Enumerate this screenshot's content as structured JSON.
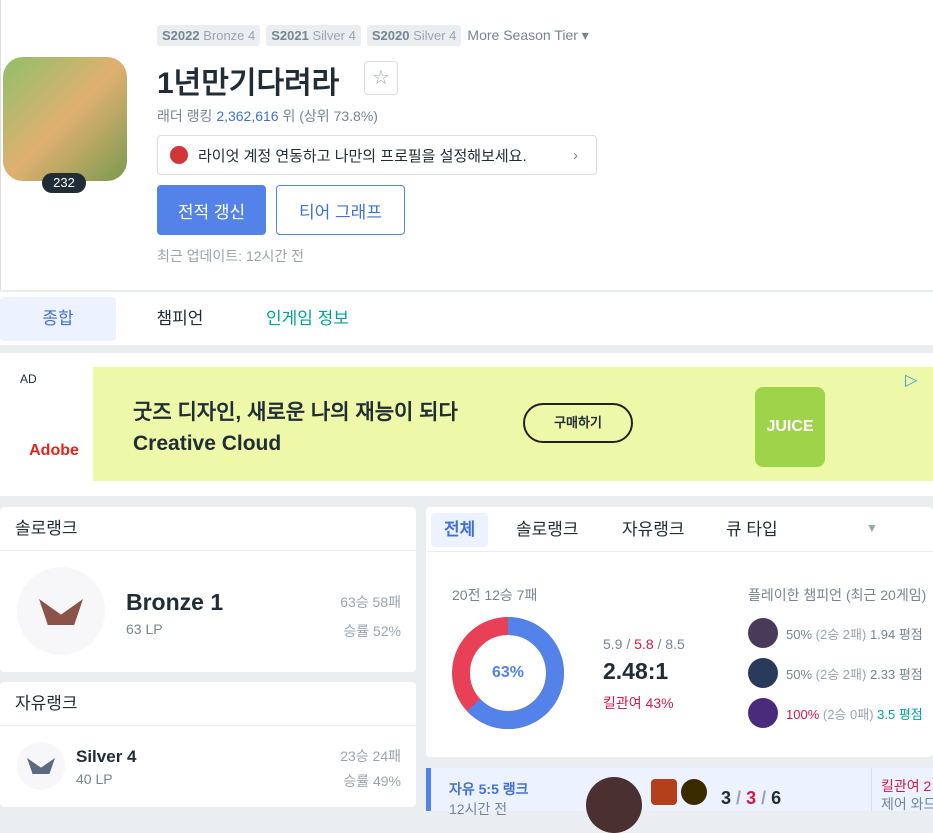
{
  "seasons": [
    {
      "s": "S2022",
      "t": "Bronze 4"
    },
    {
      "s": "S2021",
      "t": "Silver 4"
    },
    {
      "s": "S2020",
      "t": "Silver 4"
    }
  ],
  "more_season": "More Season Tier ▾",
  "profile": {
    "level": "232",
    "name": "1년만기다려라",
    "rank_label": "래더 랭킹",
    "rank_num": "2,362,616",
    "rank_suffix": "위 (상위 73.8%)",
    "riot_banner": "라이엇 계정 연동하고 나만의 프로필을 설정해보세요.",
    "refresh": "전적 갱신",
    "tier_graph": "티어 그래프",
    "updated": "최근 업데이트: 12시간 전"
  },
  "tabs": [
    "종합",
    "챔피언",
    "인게임 정보"
  ],
  "ad": {
    "label": "AD",
    "brand": "Adobe",
    "line1": "굿즈 디자인, 새로운 나의 재능이 되다",
    "line2": "Creative Cloud",
    "cta": "구매하기",
    "juice": "JUICE"
  },
  "solo": {
    "title": "솔로랭크",
    "tier": "Bronze 1",
    "lp": "63 LP",
    "record": "63승 58패",
    "winrate": "승률 52%"
  },
  "flex": {
    "title": "자유랭크",
    "tier": "Silver 4",
    "lp": "40 LP",
    "record": "23승 24패",
    "winrate": "승률 49%"
  },
  "filter": {
    "tabs": [
      "전체",
      "솔로랭크",
      "자유랭크",
      "큐 타입"
    ],
    "summary": "20전 12승 7패",
    "win_pct": 63,
    "win_label": "63%",
    "k": "5.9",
    "d": "5.8",
    "a": "8.5",
    "kda": "2.48:1",
    "kp": "킬관여 43%",
    "champs_title": "플레이한 챔피언 (최근 20게임)",
    "champs": [
      {
        "wr": "50%",
        "rec": "(2승 2패)",
        "kda": "1.94 평점",
        "color": "#4a3a5a"
      },
      {
        "wr": "50%",
        "rec": "(2승 2패)",
        "kda": "2.33 평점",
        "color": "#2a3a5a"
      },
      {
        "wr": "100%",
        "rec": "(2승 0패)",
        "kda": "3.5 평점",
        "color": "#4a2a7a"
      }
    ]
  },
  "game": {
    "type": "자유 5:5 랭크",
    "time": "12시간 전",
    "kills": "3",
    "deaths": "3",
    "assists": "6",
    "kp": "킬관여 2",
    "ward": "제어 와드"
  }
}
